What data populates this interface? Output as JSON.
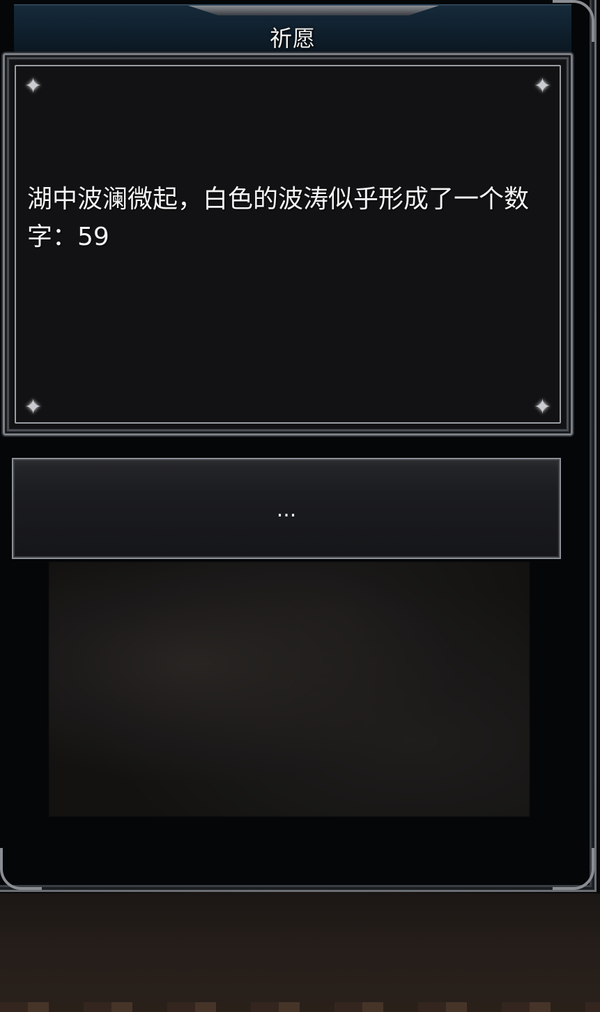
{
  "dialog": {
    "title": "祈愿",
    "message": "湖中波澜微起，白色的波涛似乎形成了一个数字：59",
    "options": [
      {
        "label": "..."
      }
    ]
  },
  "icons": {
    "corner_decoration": "sparkle-icon",
    "spark_glyph": "✦"
  },
  "colors": {
    "title_bar": "#0f1f2c",
    "frame_border": "#7c8086",
    "message_bg": "#121214",
    "text": "#f4f4f4"
  }
}
